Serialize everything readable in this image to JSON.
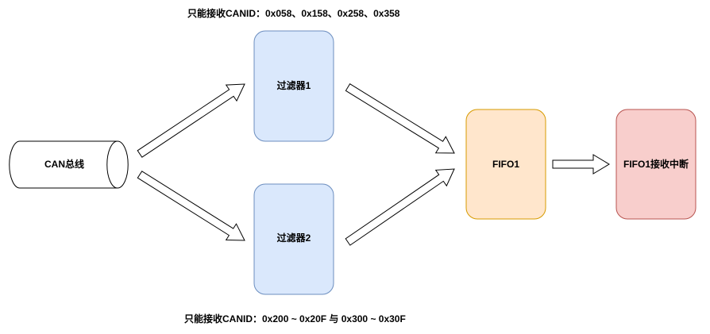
{
  "nodes": {
    "can_bus": {
      "label": "CAN总线"
    },
    "filter1": {
      "label": "过滤器1"
    },
    "filter2": {
      "label": "过滤器2"
    },
    "fifo1": {
      "label": "FIFO1"
    },
    "interrupt": {
      "label": "FIFO1接收中断"
    }
  },
  "notes": {
    "filter1": "只能接收CANID：0x058、0x158、0x258、0x358",
    "filter2": "只能接收CANID：0x200 ~ 0x20F 与 0x300 ~ 0x30F"
  },
  "colors": {
    "filter_fill": "#dae8fc",
    "filter_stroke": "#6c8ebf",
    "fifo_fill": "#ffe6cc",
    "fifo_stroke": "#d79b00",
    "interrupt_fill": "#f8cecc",
    "interrupt_stroke": "#b85450",
    "stroke": "#000000"
  }
}
